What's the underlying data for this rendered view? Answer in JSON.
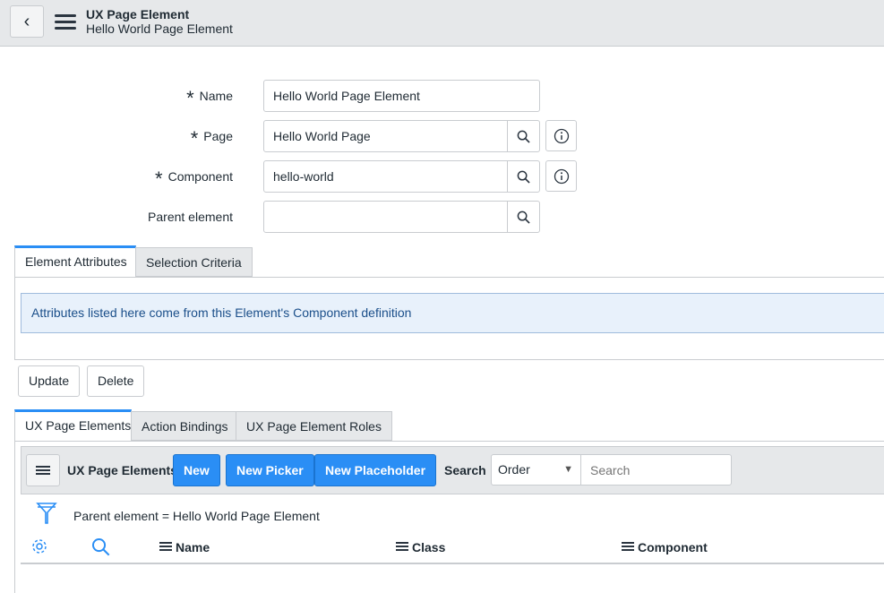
{
  "header": {
    "title": "UX Page Element",
    "subtitle": "Hello World Page Element"
  },
  "form": {
    "name": {
      "label": "Name",
      "value": "Hello World Page Element",
      "required": true
    },
    "page": {
      "label": "Page",
      "value": "Hello World Page",
      "required": true
    },
    "component": {
      "label": "Component",
      "value": "hello-world",
      "required": true
    },
    "parent": {
      "label": "Parent element",
      "value": ""
    }
  },
  "form_tabs": [
    {
      "label": "Element Attributes",
      "active": true
    },
    {
      "label": "Selection Criteria"
    }
  ],
  "info_message": "Attributes listed here come from this Element's Component definition",
  "actions": {
    "update": "Update",
    "delete": "Delete"
  },
  "related_tabs": [
    {
      "label": "UX Page Elements",
      "active": true
    },
    {
      "label": "Action Bindings"
    },
    {
      "label": "UX Page Element Roles"
    }
  ],
  "list": {
    "title": "UX Page Elements",
    "new": "New",
    "new_picker": "New Picker",
    "new_placeholder": "New Placeholder",
    "search_label": "Search",
    "search_field": "Order",
    "search_placeholder": "Search",
    "filter": "Parent element = Hello World Page Element",
    "columns": [
      "Name",
      "Class",
      "Component"
    ]
  },
  "colors": {
    "accent": "#2a8ef5",
    "info_bg": "#e8f1fb"
  }
}
